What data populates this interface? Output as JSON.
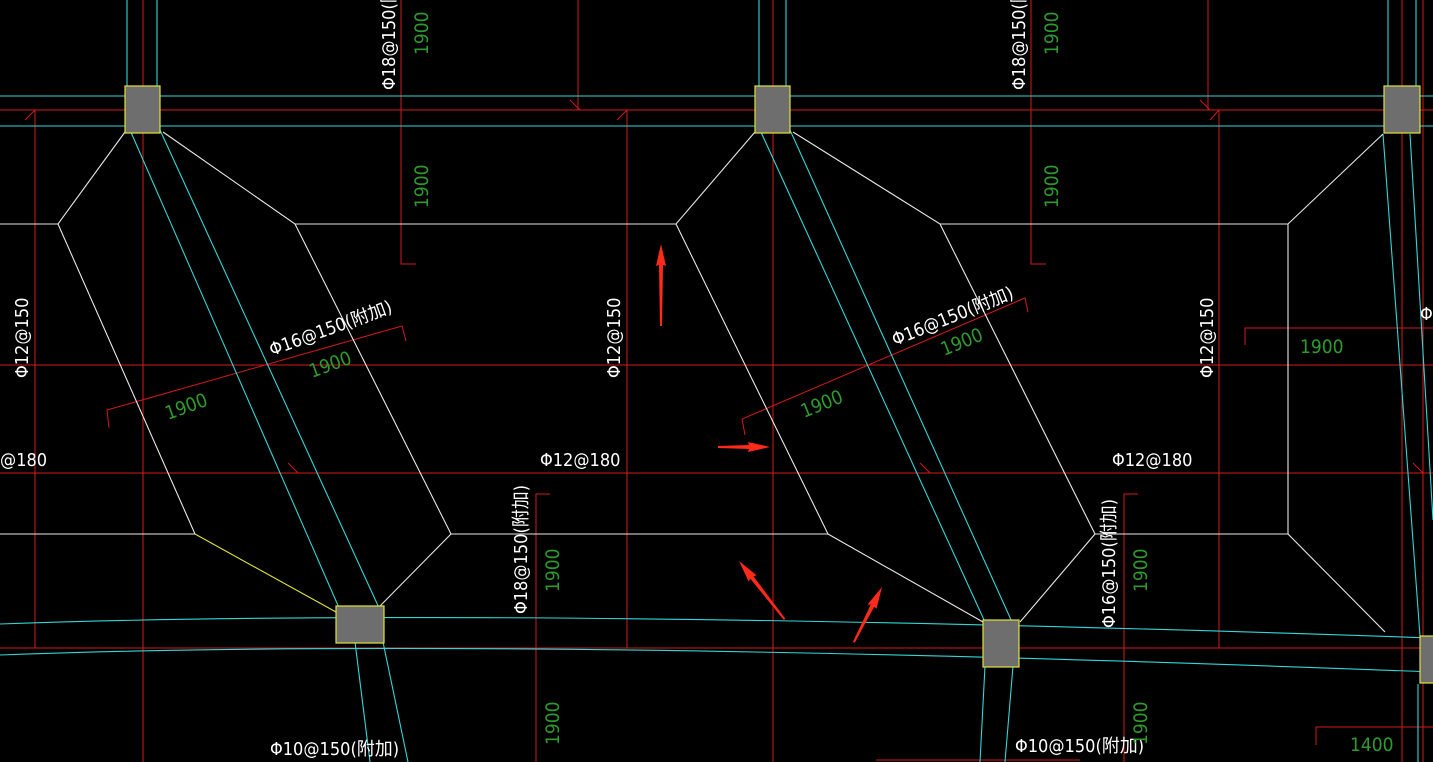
{
  "drawing": {
    "background": "#000000",
    "colors": {
      "gridline": "#d21a1a",
      "beam_edge": "#33d6d6",
      "slab_outline": "#e8e8e8",
      "column_fill": "#6e6e6e",
      "column_edge": "#e2e23a",
      "rebar_label": "#ffffff",
      "length_label": "#2e9b2e",
      "marker_arrow": "#ff2a1a"
    },
    "labels": {
      "top_rebar_1": "Φ18@150(附",
      "top_rebar_2": "Φ18@150(附",
      "top_len_1a": "1900",
      "top_len_1b": "1900",
      "top_len_2a": "1900",
      "top_len_2b": "1900",
      "left_rebar_vert_1": "Φ12@150",
      "left_rebar_vert_2": "Φ12@150",
      "left_rebar_vert_3": "Φ12@150",
      "diag_rebar_1": "Φ16@150(附加)",
      "diag_rebar_2": "Φ16@150(附加)",
      "diag_len_1a": "1900",
      "diag_len_1b": "1900",
      "diag_len_2a": "1900",
      "diag_len_2b": "1900",
      "horiz_rebar_1": "@180",
      "horiz_rebar_2": "Φ12@180",
      "horiz_rebar_3": "Φ12@180",
      "right_len_1": "1900",
      "right_top_partial": "Φ",
      "bottom_rebar_vert_1": "Φ18@150(附加)",
      "bottom_rebar_vert_2": "Φ16@150(附加)",
      "bottom_len_1a": "1900",
      "bottom_len_1b": "1900",
      "bottom_len_2a": "1900",
      "bottom_len_2b": "1900",
      "bottom_rebar_1": "Φ10@150(附加)",
      "bottom_rebar_2": "Φ10@150(附加)",
      "bottom_right_len": "1400"
    },
    "markers": [
      "red-arrow-up",
      "red-arrow-right",
      "red-arrow-upleft",
      "red-arrow-upright"
    ]
  }
}
